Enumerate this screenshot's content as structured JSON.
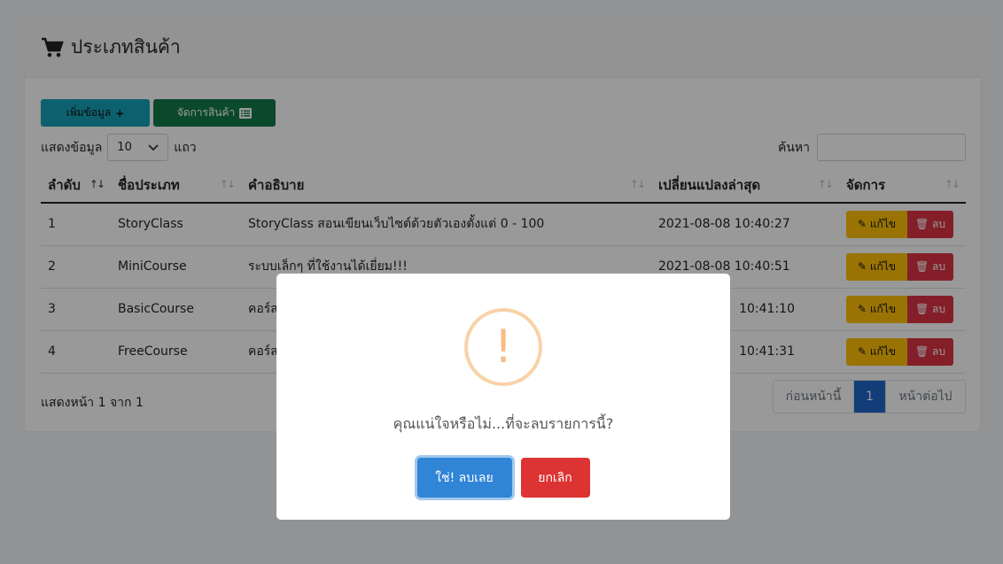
{
  "header": {
    "title": "ประเภทสินค้า",
    "icon": "cart-icon"
  },
  "toolbar": {
    "add_label": "เพิ่มข้อมูล",
    "add_icon": "+",
    "manage_label": "จัดการสินค้า",
    "manage_icon": "list-icon"
  },
  "length": {
    "label_before": "แสดงข้อมูล",
    "selected": "10",
    "label_after": "แถว"
  },
  "search": {
    "label": "ค้นหา",
    "value": ""
  },
  "table": {
    "headers": {
      "no": "ลำดับ",
      "name": "ชื่อประเภท",
      "desc": "คำอธิบาย",
      "date": "เปลี่ยนแปลงล่าสุด",
      "action": "จัดการ"
    },
    "sort_icon": "↑↓",
    "rows": [
      {
        "no": "1",
        "name": "StoryClass",
        "desc": "StoryClass สอนเขียนเว็บไซต์ด้วยตัวเองตั้งแต่ 0 - 100",
        "date": "2021-08-08 10:40:27"
      },
      {
        "no": "2",
        "name": "MiniCourse",
        "desc": "ระบบเล็กๆ ที่ใช้งานได้เยี่ยม!!!",
        "date": "2021-08-08 10:40:51"
      },
      {
        "no": "3",
        "name": "BasicCourse",
        "desc": "คอร์ส",
        "date": "10:41:10"
      },
      {
        "no": "4",
        "name": "FreeCourse",
        "desc": "คอร์ส",
        "date": "10:41:31"
      }
    ],
    "edit_label": "แก้ไข",
    "delete_label": "ลบ"
  },
  "footer": {
    "info": "แสดงหน้า 1 จาก 1",
    "prev": "ก่อนหน้านี้",
    "current": "1",
    "next": "หน้าต่อไป"
  },
  "modal": {
    "icon_text": "!",
    "message": "คุณแน่ใจหรือไม่...ที่จะลบรายการนี้?",
    "confirm_label": "ใช่! ลบเลย",
    "cancel_label": "ยกเลิก"
  }
}
